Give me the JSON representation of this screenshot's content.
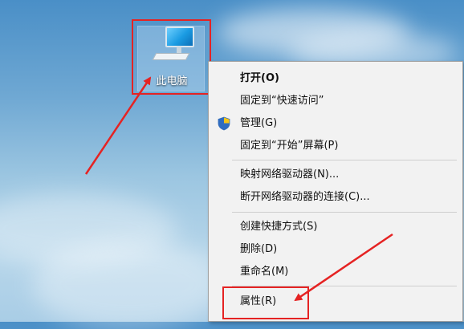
{
  "desktop": {
    "icon_label": "此电脑"
  },
  "context_menu": {
    "items": [
      {
        "label": "打开(O)"
      },
      {
        "label": "固定到“快速访问”"
      },
      {
        "label": "管理(G)"
      },
      {
        "label": "固定到“开始”屏幕(P)"
      },
      {
        "label": "映射网络驱动器(N)..."
      },
      {
        "label": "断开网络驱动器的连接(C)..."
      },
      {
        "label": "创建快捷方式(S)"
      },
      {
        "label": "删除(D)"
      },
      {
        "label": "重命名(M)"
      },
      {
        "label": "属性(R)"
      }
    ]
  },
  "colors": {
    "annotation_red": "#e52323"
  },
  "icons": {
    "desktop_icon": "computer-monitor-icon",
    "manage": "uac-shield-icon"
  }
}
